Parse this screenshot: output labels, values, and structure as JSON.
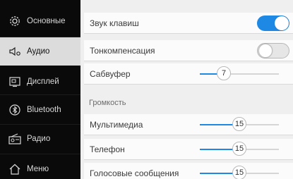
{
  "sidebar": {
    "items": [
      {
        "label": "Основные",
        "icon": "gear-icon"
      },
      {
        "label": "Аудио",
        "icon": "speaker-icon"
      },
      {
        "label": "Дисплей",
        "icon": "display-icon"
      },
      {
        "label": "Bluetooth",
        "icon": "bluetooth-icon"
      },
      {
        "label": "Радио",
        "icon": "radio-icon"
      },
      {
        "label": "Меню",
        "icon": "home-icon"
      }
    ],
    "active_index": 1
  },
  "audio": {
    "key_sound": {
      "label": "Звук клавиш",
      "value": true
    },
    "loudness": {
      "label": "Тонкомпенсация",
      "value": false
    },
    "subwoofer": {
      "label": "Сабвуфер",
      "value": "7",
      "fraction": 0.3
    },
    "volume_section": "Громкость",
    "multimedia": {
      "label": "Мультимедиа",
      "value": "15",
      "fraction": 0.5
    },
    "phone": {
      "label": "Телефон",
      "value": "15",
      "fraction": 0.5
    },
    "voice": {
      "label": "Голосовые сообщения",
      "value": "15",
      "fraction": 0.5
    }
  },
  "colors": {
    "accent": "#1e88e5",
    "sidebar_bg": "#0a0a0a",
    "active_item_bg": "#dcdcdc"
  }
}
